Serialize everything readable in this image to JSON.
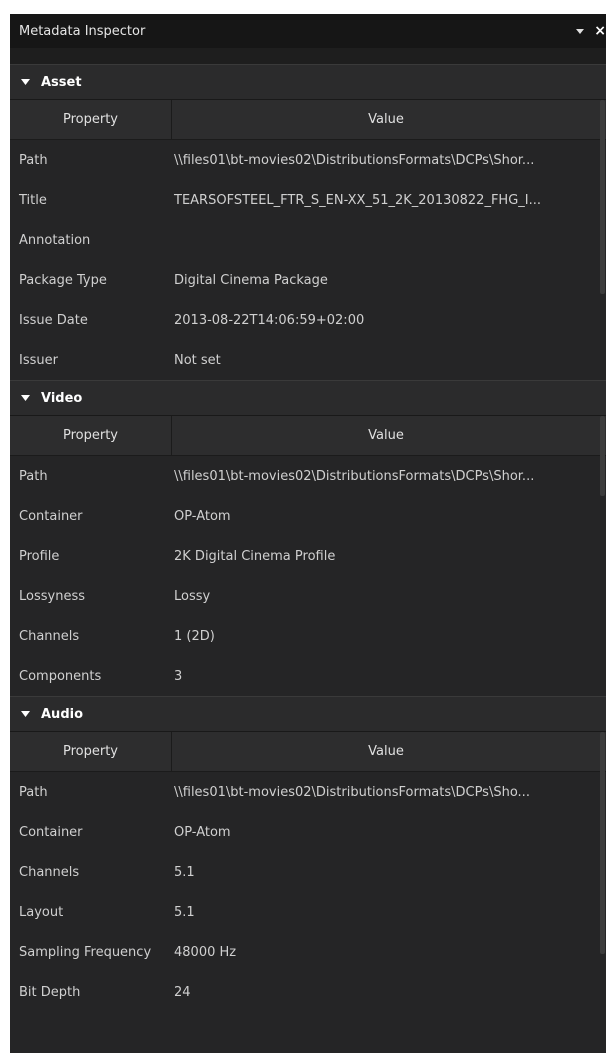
{
  "window": {
    "title": "Metadata Inspector",
    "close_glyph": "×"
  },
  "columns": {
    "property": "Property",
    "value": "Value"
  },
  "sections": [
    {
      "title": "Asset",
      "rows": [
        {
          "key": "Path",
          "value": "\\\\files01\\bt-movies02\\DistributionsFormats\\DCPs\\Shor..."
        },
        {
          "key": "Title",
          "value": "TEARSOFSTEEL_FTR_S_EN-XX_51_2K_20130822_FHG_I..."
        },
        {
          "key": "Annotation",
          "value": ""
        },
        {
          "key": "Package Type",
          "value": "Digital Cinema Package"
        },
        {
          "key": "Issue Date",
          "value": "2013-08-22T14:06:59+02:00"
        },
        {
          "key": "Issuer",
          "value": "Not set"
        }
      ]
    },
    {
      "title": "Video",
      "rows": [
        {
          "key": "Path",
          "value": "\\\\files01\\bt-movies02\\DistributionsFormats\\DCPs\\Shor..."
        },
        {
          "key": "Container",
          "value": "OP-Atom"
        },
        {
          "key": "Profile",
          "value": "2K Digital Cinema Profile"
        },
        {
          "key": "Lossyness",
          "value": "Lossy"
        },
        {
          "key": "Channels",
          "value": "1 (2D)"
        },
        {
          "key": "Components",
          "value": "3"
        }
      ]
    },
    {
      "title": "Audio",
      "rows": [
        {
          "key": "Path",
          "value": "\\\\files01\\bt-movies02\\DistributionsFormats\\DCPs\\Sho..."
        },
        {
          "key": "Container",
          "value": "OP-Atom"
        },
        {
          "key": "Channels",
          "value": "5.1"
        },
        {
          "key": "Layout",
          "value": "5.1"
        },
        {
          "key": "Sampling Frequency",
          "value": "48000 Hz"
        },
        {
          "key": "Bit Depth",
          "value": "24"
        }
      ]
    }
  ]
}
